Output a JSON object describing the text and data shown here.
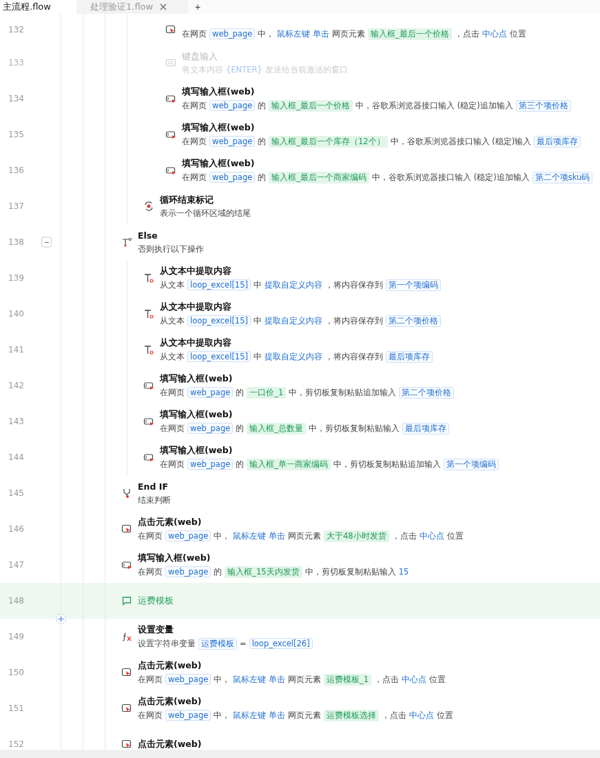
{
  "tabs": [
    {
      "label": "主流程.flow",
      "selected": true,
      "closable": false
    },
    {
      "label": "处理验证1.flow",
      "selected": false,
      "closable": true
    }
  ],
  "new_tab": "+",
  "steps": [
    {
      "children": [
        {
          "children": [
            {
              "line": "132",
              "kind": "click",
              "disabled": false,
              "desc": [
                {
                  "kind": "plain",
                  "text": "在网页"
                },
                {
                  "kind": "var",
                  "text": "web_page"
                },
                {
                  "kind": "plain",
                  "text": "中，"
                },
                {
                  "kind": "kw",
                  "text": "鼠标左键 单击"
                },
                {
                  "kind": "plain",
                  "text": "网页元素"
                },
                {
                  "kind": "elem",
                  "text": "输入框_最后一个价格"
                },
                {
                  "kind": "plain",
                  "text": "，点击"
                },
                {
                  "kind": "kw",
                  "text": "中心点"
                },
                {
                  "kind": "plain",
                  "text": "位置"
                }
              ]
            },
            {
              "line": "133",
              "kind": "keyboard",
              "disabled": true,
              "title": "键盘输入",
              "desc": [
                {
                  "kind": "plain",
                  "text": "将文本内容"
                },
                {
                  "kind": "kw",
                  "text": "{ENTER}"
                },
                {
                  "kind": "plain",
                  "text": "发送给当前激活的窗口"
                }
              ]
            },
            {
              "line": "134",
              "kind": "fill",
              "disabled": false,
              "title": "填写输入框(web)",
              "desc": [
                {
                  "kind": "plain",
                  "text": "在网页"
                },
                {
                  "kind": "var",
                  "text": "web_page"
                },
                {
                  "kind": "plain",
                  "text": "的"
                },
                {
                  "kind": "elem",
                  "text": "输入框_最后一个价格"
                },
                {
                  "kind": "plain",
                  "text": "中，谷歌系浏览器接口输入 (稳定)追加输入"
                },
                {
                  "kind": "var",
                  "text": "第三个项价格"
                }
              ]
            },
            {
              "line": "135",
              "kind": "fill",
              "disabled": false,
              "title": "填写输入框(web)",
              "desc": [
                {
                  "kind": "plain",
                  "text": "在网页"
                },
                {
                  "kind": "var",
                  "text": "web_page"
                },
                {
                  "kind": "plain",
                  "text": "的"
                },
                {
                  "kind": "elem",
                  "text": "输入框_最后一个库存（12个）"
                },
                {
                  "kind": "plain",
                  "text": "中，谷歌系浏览器接口输入 (稳定)输入"
                },
                {
                  "kind": "var",
                  "text": "最后项库存"
                }
              ]
            },
            {
              "line": "136",
              "kind": "fill",
              "disabled": false,
              "title": "填写输入框(web)",
              "desc": [
                {
                  "kind": "plain",
                  "text": "在网页"
                },
                {
                  "kind": "var",
                  "text": "web_page"
                },
                {
                  "kind": "plain",
                  "text": "的"
                },
                {
                  "kind": "elem",
                  "text": "输入框_最后一个商家编码"
                },
                {
                  "kind": "plain",
                  "text": "中，谷歌系浏览器接口输入 (稳定)追加输入"
                },
                {
                  "kind": "var",
                  "text": "第二个项sku码"
                }
              ]
            }
          ]
        },
        {
          "line": "137",
          "kind": "loop_end",
          "disabled": false,
          "title": "循环结束标记",
          "desc": [
            {
              "kind": "plain",
              "text": "表示一个循环区域的结尾"
            }
          ]
        }
      ]
    },
    {
      "line": "138",
      "kind": "else",
      "disabled": false,
      "expanded": true,
      "title": "Else",
      "desc": [
        {
          "kind": "plain",
          "text": "否则执行以下操作"
        }
      ],
      "children": [
        {
          "line": "139",
          "kind": "extract",
          "disabled": false,
          "title": "从文本中提取内容",
          "desc": [
            {
              "kind": "plain",
              "text": "从文本"
            },
            {
              "kind": "var",
              "text": "loop_excel[15]"
            },
            {
              "kind": "plain",
              "text": "中"
            },
            {
              "kind": "kw",
              "text": "提取自定义内容"
            },
            {
              "kind": "plain",
              "text": "，将内容保存到"
            },
            {
              "kind": "var",
              "text": "第一个项编码"
            }
          ]
        },
        {
          "line": "140",
          "kind": "extract",
          "disabled": false,
          "title": "从文本中提取内容",
          "desc": [
            {
              "kind": "plain",
              "text": "从文本"
            },
            {
              "kind": "var",
              "text": "loop_excel[15]"
            },
            {
              "kind": "plain",
              "text": "中"
            },
            {
              "kind": "kw",
              "text": "提取自定义内容"
            },
            {
              "kind": "plain",
              "text": "，将内容保存到"
            },
            {
              "kind": "var",
              "text": "第二个项价格"
            }
          ]
        },
        {
          "line": "141",
          "kind": "extract",
          "disabled": false,
          "title": "从文本中提取内容",
          "desc": [
            {
              "kind": "plain",
              "text": "从文本"
            },
            {
              "kind": "var",
              "text": "loop_excel[15]"
            },
            {
              "kind": "plain",
              "text": "中"
            },
            {
              "kind": "kw",
              "text": "提取自定义内容"
            },
            {
              "kind": "plain",
              "text": "，将内容保存到"
            },
            {
              "kind": "var",
              "text": "最后项库存"
            }
          ]
        },
        {
          "line": "142",
          "kind": "fill",
          "disabled": false,
          "title": "填写输入框(web)",
          "desc": [
            {
              "kind": "plain",
              "text": "在网页"
            },
            {
              "kind": "var",
              "text": "web_page"
            },
            {
              "kind": "plain",
              "text": "的"
            },
            {
              "kind": "elem",
              "text": "一口价_1"
            },
            {
              "kind": "plain",
              "text": "中，剪切板复制粘贴追加输入"
            },
            {
              "kind": "var",
              "text": "第二个项价格"
            }
          ]
        },
        {
          "line": "143",
          "kind": "fill",
          "disabled": false,
          "title": "填写输入框(web)",
          "desc": [
            {
              "kind": "plain",
              "text": "在网页"
            },
            {
              "kind": "var",
              "text": "web_page"
            },
            {
              "kind": "plain",
              "text": "的"
            },
            {
              "kind": "elem",
              "text": "输入框_总数量"
            },
            {
              "kind": "plain",
              "text": "中，剪切板复制粘贴输入"
            },
            {
              "kind": "var",
              "text": "最后项库存"
            }
          ]
        },
        {
          "line": "144",
          "kind": "fill",
          "disabled": false,
          "title": "填写输入框(web)",
          "desc": [
            {
              "kind": "plain",
              "text": "在网页"
            },
            {
              "kind": "var",
              "text": "web_page"
            },
            {
              "kind": "plain",
              "text": "的"
            },
            {
              "kind": "elem",
              "text": "输入框_单一商家编码"
            },
            {
              "kind": "plain",
              "text": "中，剪切板复制粘贴追加输入"
            },
            {
              "kind": "var",
              "text": "第一个项编码"
            }
          ]
        }
      ]
    },
    {
      "line": "145",
      "kind": "endif",
      "disabled": false,
      "title": "End IF",
      "desc": [
        {
          "kind": "plain",
          "text": "结束判断"
        }
      ]
    },
    {
      "line": "146",
      "kind": "click",
      "disabled": false,
      "title": "点击元素(web)",
      "desc": [
        {
          "kind": "plain",
          "text": "在网页"
        },
        {
          "kind": "var",
          "text": "web_page"
        },
        {
          "kind": "plain",
          "text": "中，"
        },
        {
          "kind": "kw",
          "text": "鼠标左键 单击"
        },
        {
          "kind": "plain",
          "text": "网页元素"
        },
        {
          "kind": "elem",
          "text": "大于48小时发货"
        },
        {
          "kind": "plain",
          "text": "，点击"
        },
        {
          "kind": "kw",
          "text": "中心点"
        },
        {
          "kind": "plain",
          "text": "位置"
        }
      ]
    },
    {
      "line": "147",
      "kind": "fill",
      "disabled": false,
      "title": "填写输入框(web)",
      "desc": [
        {
          "kind": "plain",
          "text": "在网页"
        },
        {
          "kind": "var",
          "text": "web_page"
        },
        {
          "kind": "plain",
          "text": "的"
        },
        {
          "kind": "elem",
          "text": "输入框_15天内发货"
        },
        {
          "kind": "plain",
          "text": "中，剪切板复制粘贴输入"
        },
        {
          "kind": "kw",
          "text": "15"
        }
      ]
    },
    {
      "line": "148",
      "kind": "comment",
      "disabled": false,
      "title": "运费模板"
    },
    {
      "line": "149",
      "kind": "setvar",
      "disabled": false,
      "title": "设置变量",
      "desc": [
        {
          "kind": "plain",
          "text": "设置字符串变量"
        },
        {
          "kind": "var",
          "text": "运费模板"
        },
        {
          "kind": "plain",
          "text": "="
        },
        {
          "kind": "var",
          "text": "loop_excel[26]"
        }
      ]
    },
    {
      "line": "150",
      "kind": "click",
      "disabled": false,
      "title": "点击元素(web)",
      "desc": [
        {
          "kind": "plain",
          "text": "在网页"
        },
        {
          "kind": "var",
          "text": "web_page"
        },
        {
          "kind": "plain",
          "text": "中，"
        },
        {
          "kind": "kw",
          "text": "鼠标左键 单击"
        },
        {
          "kind": "plain",
          "text": "网页元素"
        },
        {
          "kind": "elem",
          "text": "运费模板_1"
        },
        {
          "kind": "plain",
          "text": "，点击"
        },
        {
          "kind": "kw",
          "text": "中心点"
        },
        {
          "kind": "plain",
          "text": "位置"
        }
      ]
    },
    {
      "line": "151",
      "kind": "click",
      "disabled": false,
      "title": "点击元素(web)",
      "desc": [
        {
          "kind": "plain",
          "text": "在网页"
        },
        {
          "kind": "var",
          "text": "web_page"
        },
        {
          "kind": "plain",
          "text": "中，"
        },
        {
          "kind": "kw",
          "text": "鼠标左键 单击"
        },
        {
          "kind": "plain",
          "text": "网页元素"
        },
        {
          "kind": "elem",
          "text": "运费模板选择"
        },
        {
          "kind": "plain",
          "text": "，点击"
        },
        {
          "kind": "kw",
          "text": "中心点"
        },
        {
          "kind": "plain",
          "text": "位置"
        }
      ]
    },
    {
      "line": "152",
      "kind": "click",
      "disabled": false,
      "title": "点击元素(web)"
    }
  ]
}
